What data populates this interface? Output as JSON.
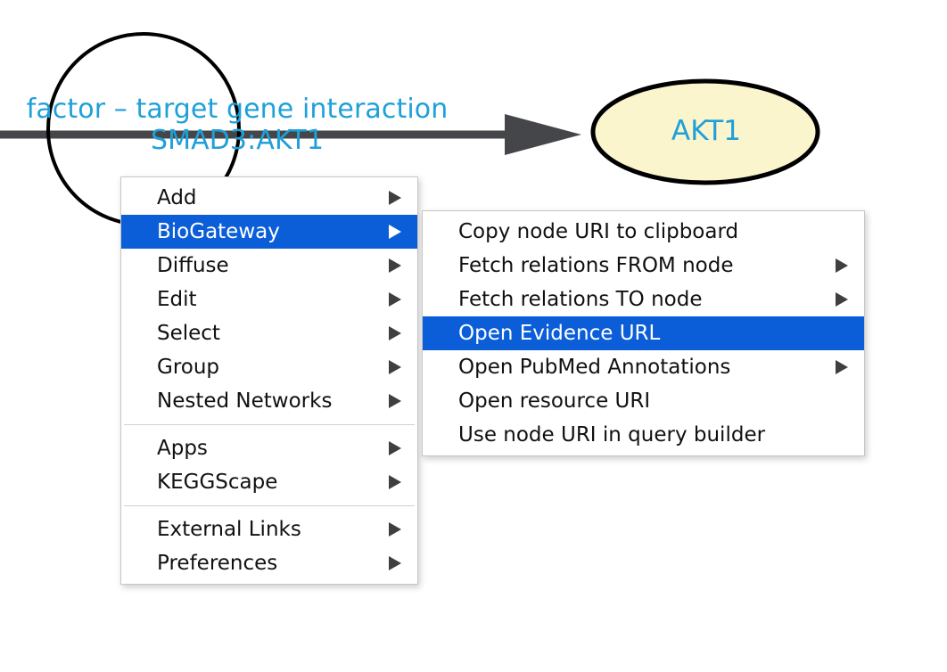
{
  "canvas": {
    "background_color": "#ffffff",
    "edge": {
      "name": "directed-edge",
      "color": "#45464a",
      "arrowhead": "solid-triangle"
    },
    "nodes": [
      {
        "id": "source-node",
        "shape": "circle",
        "fill": "#ffffff",
        "border_color": "#000000",
        "label": "factor – target gene interaction\nSMAD3:AKT1",
        "label_color": "#1fa0d9"
      },
      {
        "id": "akt1-node",
        "shape": "ellipse",
        "fill": "#faf5cd",
        "border_color": "#000000",
        "label": "AKT1",
        "label_color": "#1fa0d9"
      }
    ]
  },
  "context_menu": {
    "name": "node-context-menu",
    "highlight_color": "#0b5ed7",
    "groups": [
      [
        {
          "label": "Add",
          "has_submenu": true,
          "selected": false
        },
        {
          "label": "BioGateway",
          "has_submenu": true,
          "selected": true
        },
        {
          "label": "Diffuse",
          "has_submenu": true,
          "selected": false
        },
        {
          "label": "Edit",
          "has_submenu": true,
          "selected": false
        },
        {
          "label": "Select",
          "has_submenu": true,
          "selected": false
        },
        {
          "label": "Group",
          "has_submenu": true,
          "selected": false
        },
        {
          "label": "Nested Networks",
          "has_submenu": true,
          "selected": false
        }
      ],
      [
        {
          "label": "Apps",
          "has_submenu": true,
          "selected": false
        },
        {
          "label": "KEGGScape",
          "has_submenu": true,
          "selected": false
        }
      ],
      [
        {
          "label": "External Links",
          "has_submenu": true,
          "selected": false
        },
        {
          "label": "Preferences",
          "has_submenu": true,
          "selected": false
        }
      ]
    ]
  },
  "submenu": {
    "name": "biogateway-submenu",
    "parent_label": "BioGateway",
    "highlight_color": "#0b5ed7",
    "items": [
      {
        "label": "Copy node URI to clipboard",
        "has_submenu": false,
        "selected": false
      },
      {
        "label": "Fetch relations FROM node",
        "has_submenu": true,
        "selected": false
      },
      {
        "label": "Fetch relations TO node",
        "has_submenu": true,
        "selected": false
      },
      {
        "label": "Open Evidence URL",
        "has_submenu": false,
        "selected": true
      },
      {
        "label": "Open PubMed Annotations",
        "has_submenu": true,
        "selected": false
      },
      {
        "label": "Open resource URI",
        "has_submenu": false,
        "selected": false
      },
      {
        "label": "Use node URI in query builder",
        "has_submenu": false,
        "selected": false
      }
    ]
  }
}
